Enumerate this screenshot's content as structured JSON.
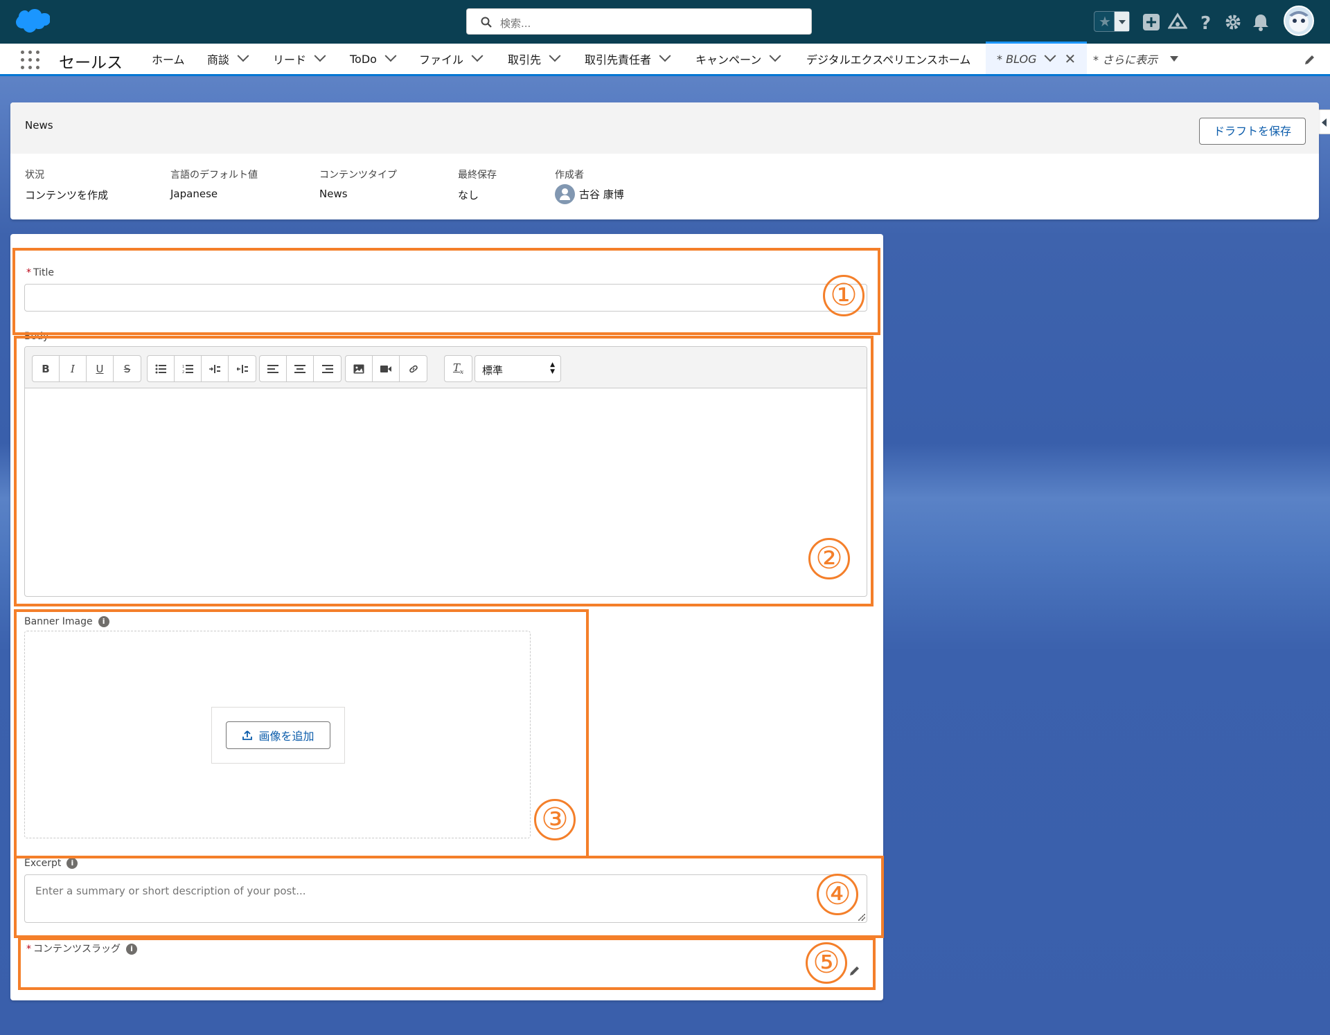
{
  "header": {
    "search_placeholder": "検索...",
    "icons": [
      "favorites-star-icon",
      "add-icon",
      "trailhead-icon",
      "help-icon",
      "setup-gear-icon",
      "notifications-bell-icon",
      "avatar"
    ]
  },
  "nav": {
    "app_name": "セールス",
    "tabs": [
      {
        "label": "ホーム",
        "has_menu": false
      },
      {
        "label": "商談",
        "has_menu": true
      },
      {
        "label": "リード",
        "has_menu": true
      },
      {
        "label": "ToDo",
        "has_menu": true
      },
      {
        "label": "ファイル",
        "has_menu": true
      },
      {
        "label": "取引先",
        "has_menu": true
      },
      {
        "label": "取引先責任者",
        "has_menu": true
      },
      {
        "label": "キャンペーン",
        "has_menu": true
      },
      {
        "label": "デジタルエクスペリエンスホーム",
        "has_menu": false
      }
    ],
    "active_tab": "* BLOG",
    "more": "* さらに表示"
  },
  "record": {
    "title": "News",
    "save_draft": "ドラフトを保存",
    "fields": [
      {
        "label": "状況",
        "value": "コンテンツを作成"
      },
      {
        "label": "言語のデフォルト値",
        "value": "Japanese"
      },
      {
        "label": "コンテンツタイプ",
        "value": "News"
      },
      {
        "label": "最終保存",
        "value": "なし"
      },
      {
        "label": "作成者",
        "value": "古谷 康博"
      }
    ]
  },
  "form": {
    "title_label": "Title",
    "title_value": "",
    "body_label": "Body",
    "format_select": "標準",
    "banner_label": "Banner Image",
    "add_image": "画像を追加",
    "excerpt_label": "Excerpt",
    "excerpt_placeholder": "Enter a summary or short description of your post...",
    "slug_label": "コンテンツスラッグ"
  },
  "annotations": {
    "color": "#f47f2a",
    "numbers": [
      "①",
      "②",
      "③",
      "④",
      "⑤"
    ]
  },
  "colors": {
    "header_bg": "#0b3f52",
    "brand_blue": "#0176d3",
    "link_blue": "#0b5cab",
    "required_red": "#ba0517"
  }
}
